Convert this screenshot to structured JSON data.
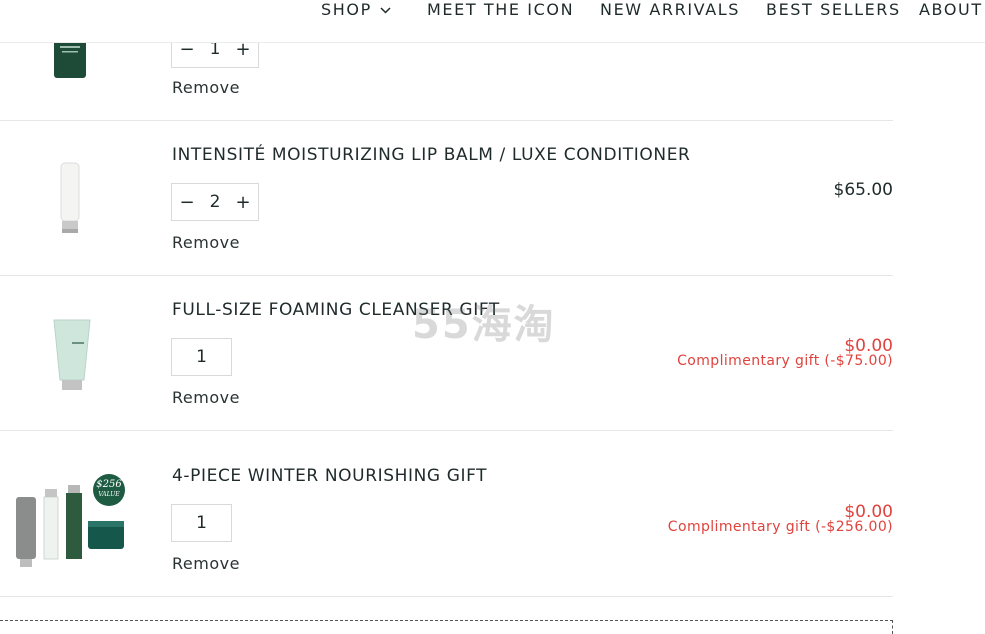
{
  "nav": {
    "items": [
      "SHOP",
      "MEET THE ICON",
      "NEW ARRIVALS",
      "BEST SELLERS",
      "ABOUT"
    ]
  },
  "cart": {
    "remove_label": "Remove",
    "rows": [
      {
        "title": "",
        "qty": "1",
        "price": "",
        "note": ""
      },
      {
        "title": "INTENSITÉ MOISTURIZING LIP BALM / LUXE CONDITIONER",
        "qty": "2",
        "price": "$65.00",
        "note": ""
      },
      {
        "title": "FULL-SIZE FOAMING CLEANSER GIFT",
        "qty": "1",
        "price": "$0.00",
        "note": "Complimentary gift (-$75.00)"
      },
      {
        "title": "4-PIECE WINTER NOURISHING GIFT",
        "qty": "1",
        "price": "$0.00",
        "note": "Complimentary gift (-$256.00)"
      }
    ]
  },
  "badge": {
    "line1": "$256",
    "line2": "VALUE"
  },
  "watermark": "55海淘",
  "colors": {
    "accent_red": "#e0433d",
    "brand_green": "#1d5c43",
    "text_dark": "#1f2a2a"
  }
}
